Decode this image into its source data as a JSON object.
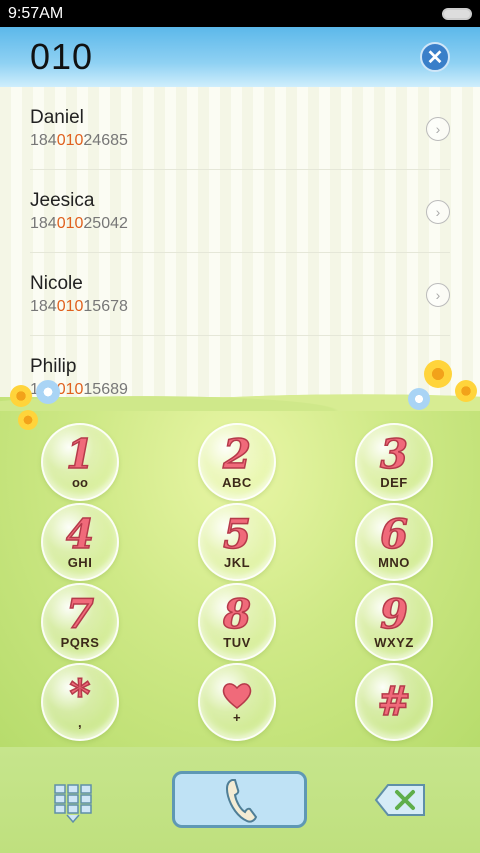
{
  "status_bar": {
    "time": "9:57AM"
  },
  "header": {
    "number": "010",
    "clear_icon": "close-icon"
  },
  "contacts": [
    {
      "name": "Daniel",
      "number_prefix": "184",
      "number_match": "010",
      "number_suffix": "24685"
    },
    {
      "name": "Jeesica",
      "number_prefix": "184",
      "number_match": "010",
      "number_suffix": "25042"
    },
    {
      "name": "Nicole",
      "number_prefix": "184",
      "number_match": "010",
      "number_suffix": "15678"
    },
    {
      "name": "Philip",
      "number_prefix": "184",
      "number_match": "010",
      "number_suffix": "15689"
    }
  ],
  "keypad": {
    "keys": [
      {
        "digit": "1",
        "letters": ""
      },
      {
        "digit": "2",
        "letters": "ABC"
      },
      {
        "digit": "3",
        "letters": "DEF"
      },
      {
        "digit": "4",
        "letters": "GHI"
      },
      {
        "digit": "5",
        "letters": "JKL"
      },
      {
        "digit": "6",
        "letters": "MNO"
      },
      {
        "digit": "7",
        "letters": "PQRS"
      },
      {
        "digit": "8",
        "letters": "TUV"
      },
      {
        "digit": "9",
        "letters": "WXYZ"
      },
      {
        "digit": "*",
        "letters": ","
      },
      {
        "digit": "",
        "letters": "+"
      },
      {
        "digit": "#",
        "letters": ""
      }
    ]
  },
  "colors": {
    "digit": "#f06a7a",
    "match_highlight": "#e0611e",
    "header_blue": "#5cb8ea",
    "grass": "#c6e58c"
  }
}
